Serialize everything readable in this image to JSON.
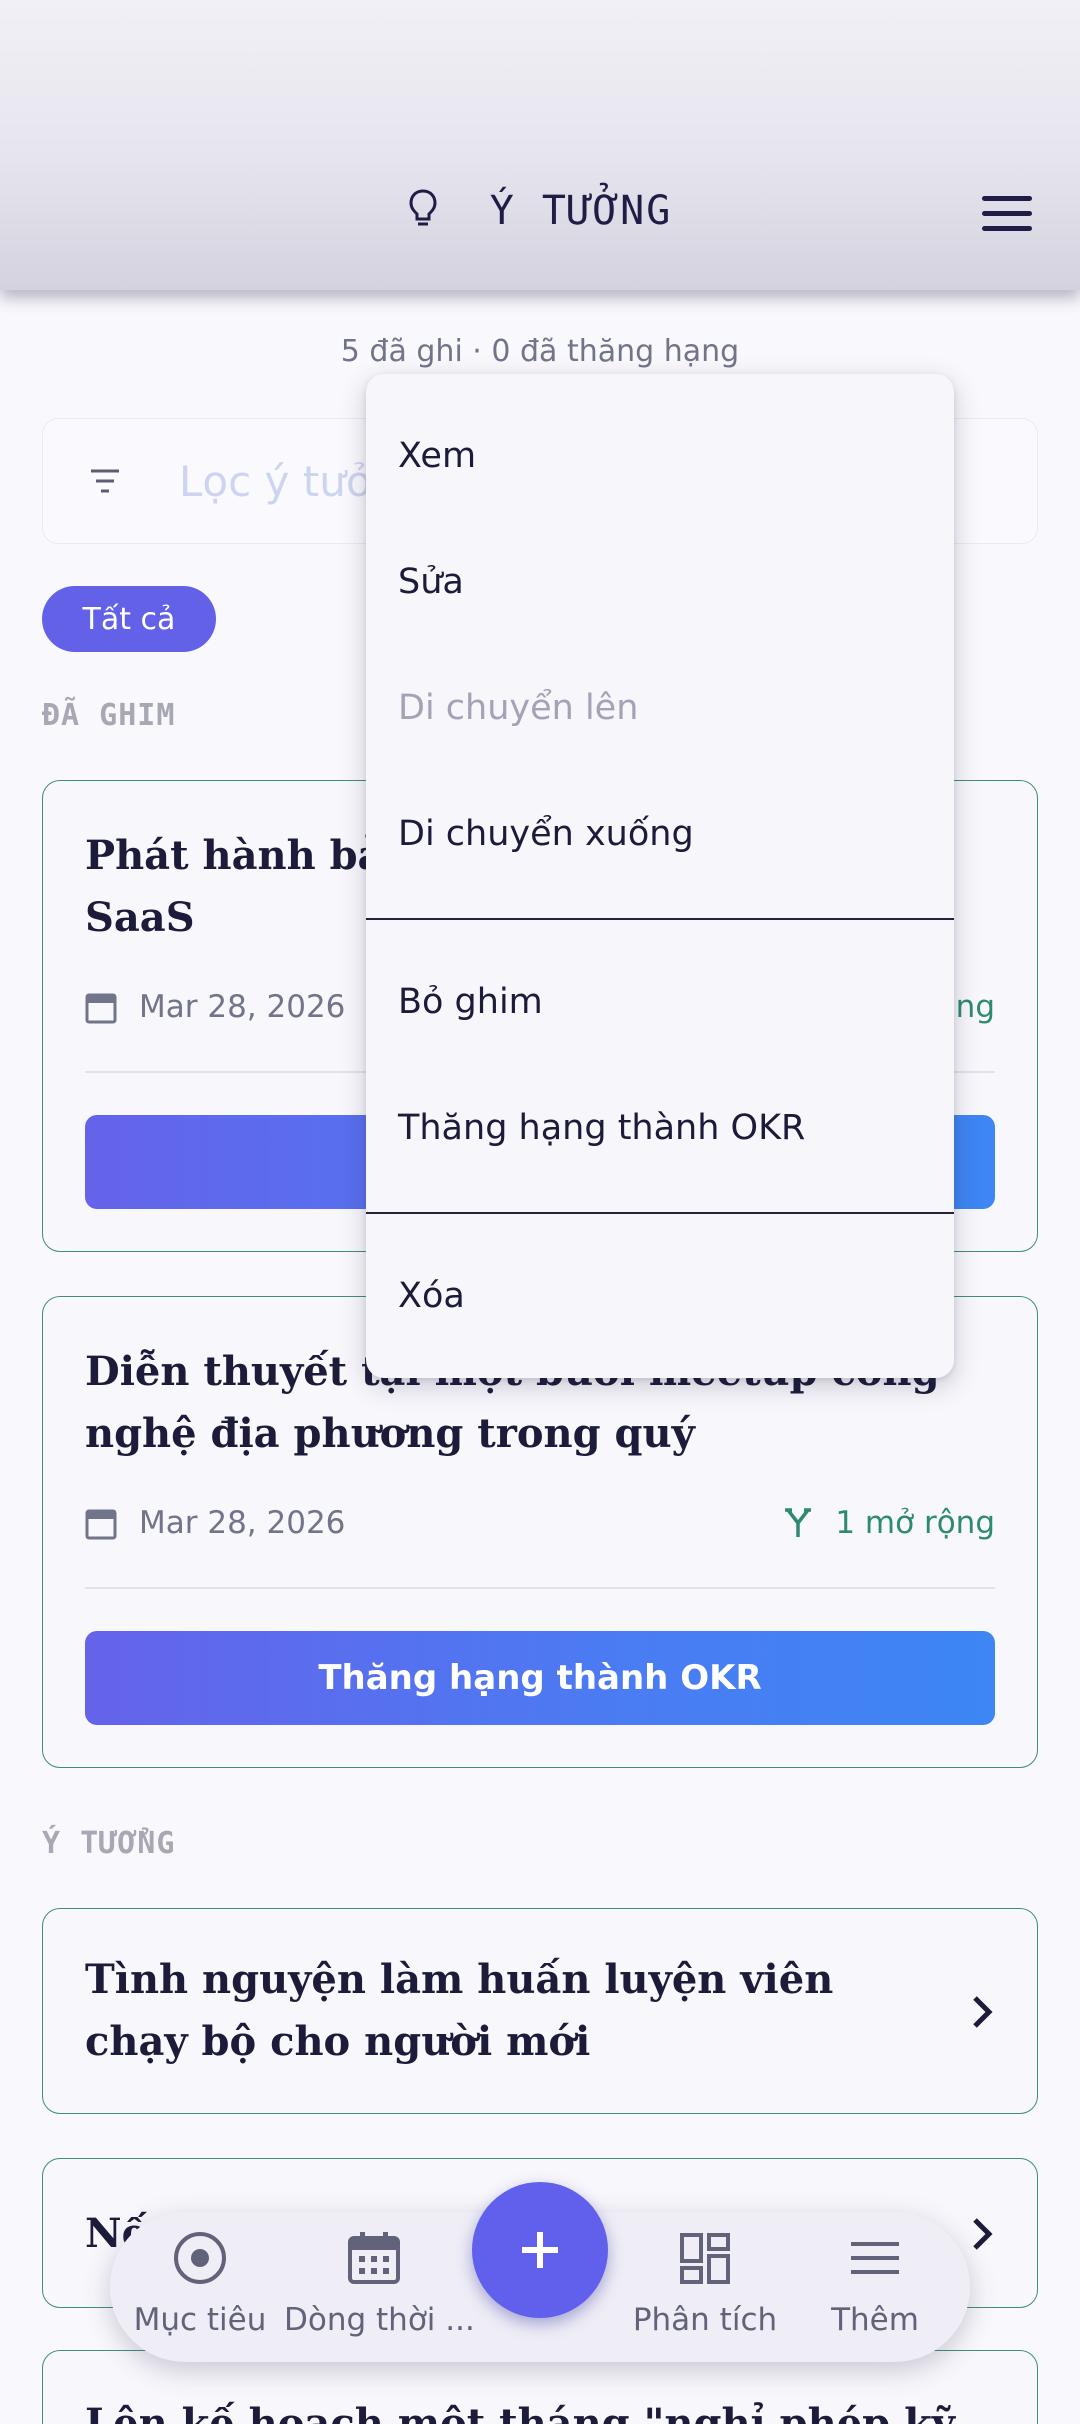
{
  "header": {
    "title": "Ý TƯỞNG",
    "menu_icon": "hamburger-menu-icon",
    "title_icon": "lightbulb-icon"
  },
  "stats": "5 đã ghi · 0 đã thăng hạng",
  "filter": {
    "placeholder": "Lọc ý tưở",
    "icon": "filter-icon"
  },
  "chip": {
    "label": "Tất cả",
    "color": "#6261e8"
  },
  "sections": {
    "pinned": "ĐÃ GHIM",
    "ideas": "Ý TƯỞNG"
  },
  "pinned_cards": [
    {
      "title": "Phát hành bản\nSaaS",
      "date": "Mar 28, 2026",
      "expansions": "ộng",
      "button": "T"
    },
    {
      "title": "Diễn thuyết tại một buổi meetup công nghệ địa phương trong quý",
      "date": "Mar 28, 2026",
      "expansions": "1 mở rộng",
      "button": "Thăng hạng thành OKR"
    }
  ],
  "idea_cards": [
    {
      "title": "Tình nguyện làm huấn luyện viên chạy bộ cho người mới"
    },
    {
      "title": "Nế"
    },
    {
      "title": "Lên kế hoạch một tháng \"nghỉ phép kỹ"
    }
  ],
  "dropdown": {
    "items": [
      {
        "label": "Xem",
        "enabled": true
      },
      {
        "label": "Sửa",
        "enabled": true
      },
      {
        "label": "Di chuyển lên",
        "enabled": false
      },
      {
        "label": "Di chuyển xuống",
        "enabled": true
      },
      {
        "label": "Bỏ ghim",
        "enabled": true
      },
      {
        "label": "Thăng hạng thành OKR",
        "enabled": true
      },
      {
        "label": "Xóa",
        "enabled": true
      }
    ]
  },
  "bottom_nav": {
    "items": [
      {
        "label": "Mục tiêu",
        "icon": "target-icon"
      },
      {
        "label": "Dòng thời ...",
        "icon": "calendar-icon"
      },
      {
        "label": "Phân tích",
        "icon": "dashboard-icon"
      },
      {
        "label": "Thêm",
        "icon": "menu-icon"
      }
    ],
    "fab_icon": "plus-icon"
  },
  "colors": {
    "accent": "#6261e8",
    "teal": "#2e8a72",
    "text": "#1c1b3a"
  }
}
